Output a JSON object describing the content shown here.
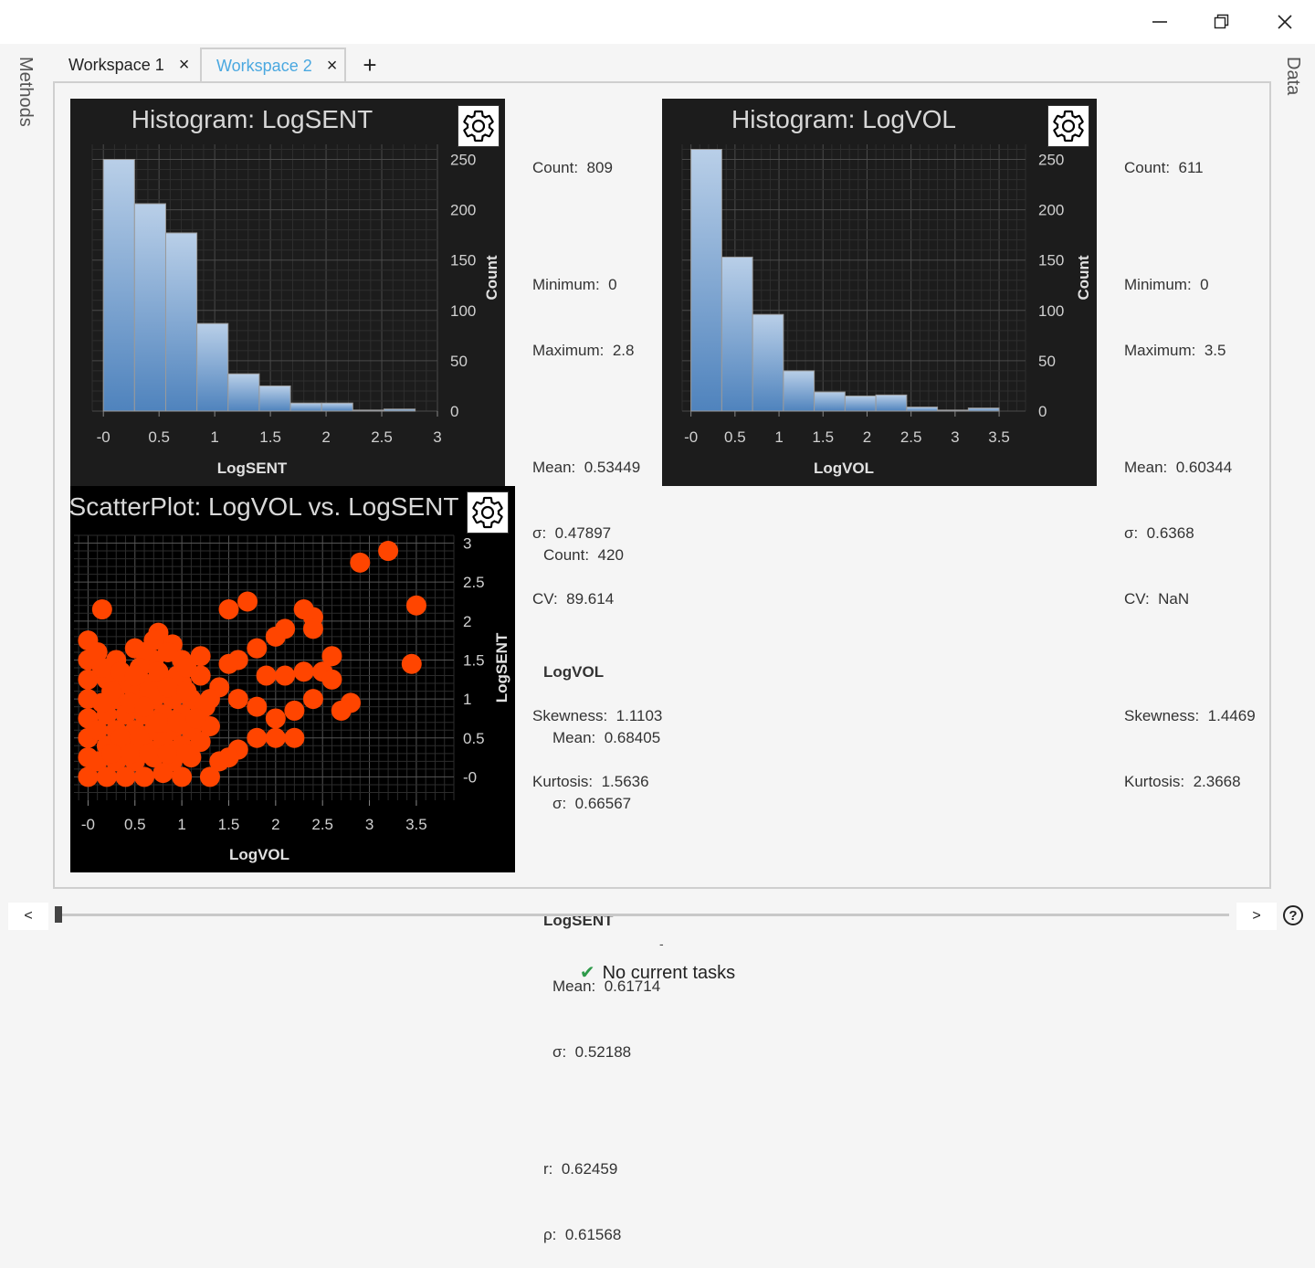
{
  "window": {
    "minimize_glyph": "—",
    "restore_glyph": "❐",
    "close_glyph": "✕"
  },
  "side": {
    "left_label": "Methods",
    "right_label": "Data"
  },
  "tabs": [
    {
      "label": "Workspace 1",
      "close": "×"
    },
    {
      "label": "Workspace 2",
      "close": "×"
    }
  ],
  "add_tab": "+",
  "histograms": [
    {
      "title": "Histogram: LogSENT",
      "xlabel": "LogSENT",
      "ylabel": "Count",
      "stats": {
        "count": "Count:  809",
        "min": "Minimum:  0",
        "max": "Maximum:  2.8",
        "mean": "Mean:  0.53449",
        "sigma": "σ:  0.47897",
        "cv": "CV:  89.614",
        "skew": "Skewness:  1.1103",
        "kurt": "Kurtosis:  1.5636"
      }
    },
    {
      "title": "Histogram: LogVOL",
      "xlabel": "LogVOL",
      "ylabel": "Count",
      "stats": {
        "count": "Count:  611",
        "min": "Minimum:  0",
        "max": "Maximum:  3.5",
        "mean": "Mean:  0.60344",
        "sigma": "σ:  0.6368",
        "cv": "CV:  NaN",
        "skew": "Skewness:  1.4469",
        "kurt": "Kurtosis:  2.3668"
      }
    }
  ],
  "scatter": {
    "title": "ScatterPlot: LogVOL vs. LogSENT",
    "xlabel": "LogVOL",
    "ylabel": "LogSENT",
    "stats": {
      "count": "Count:  420",
      "var1": "LogVOL",
      "var1_mean": "Mean:  0.68405",
      "var1_sigma": "σ:  0.66567",
      "var2": "LogSENT",
      "var2_mean": "Mean:  0.61714",
      "var2_sigma": "σ:  0.52188",
      "r": "r:  0.62459",
      "rho": "ρ:  0.61568"
    }
  },
  "chart_data": [
    {
      "type": "bar",
      "title": "Histogram: LogSENT",
      "xlabel": "LogSENT",
      "ylabel": "Count",
      "x_ticks": [
        "-0",
        "0.5",
        "1",
        "1.5",
        "2",
        "2.5",
        "3"
      ],
      "y_ticks": [
        "0",
        "50",
        "100",
        "150",
        "200",
        "250"
      ],
      "bin_width": 0.28,
      "bin_starts": [
        0,
        0.28,
        0.56,
        0.84,
        1.12,
        1.4,
        1.68,
        1.96,
        2.24,
        2.52
      ],
      "values": [
        250,
        206,
        177,
        87,
        37,
        25,
        8,
        8,
        1,
        2
      ],
      "xlim": [
        -0.1,
        3.0
      ],
      "ylim": [
        0,
        265
      ]
    },
    {
      "type": "bar",
      "title": "Histogram: LogVOL",
      "xlabel": "LogVOL",
      "ylabel": "Count",
      "x_ticks": [
        "-0",
        "0.5",
        "1",
        "1.5",
        "2",
        "2.5",
        "3",
        "3.5"
      ],
      "y_ticks": [
        "0",
        "50",
        "100",
        "150",
        "200",
        "250"
      ],
      "bin_width": 0.35,
      "bin_starts": [
        0,
        0.35,
        0.7,
        1.05,
        1.4,
        1.75,
        2.1,
        2.45,
        2.8,
        3.15
      ],
      "values": [
        260,
        153,
        96,
        40,
        19,
        15,
        16,
        4,
        1,
        3
      ],
      "xlim": [
        -0.1,
        3.8
      ],
      "ylim": [
        0,
        265
      ]
    },
    {
      "type": "scatter",
      "title": "ScatterPlot: LogVOL vs. LogSENT",
      "xlabel": "LogVOL",
      "ylabel": "LogSENT",
      "x_ticks": [
        "-0",
        "0.5",
        "1",
        "1.5",
        "2",
        "2.5",
        "3",
        "3.5"
      ],
      "y_ticks": [
        "-0",
        "0.5",
        "1",
        "1.5",
        "2",
        "2.5",
        "3"
      ],
      "xlim": [
        -0.15,
        3.9
      ],
      "ylim": [
        -0.3,
        3.1
      ],
      "point_color": "#ff4500",
      "points": [
        [
          3.2,
          2.9
        ],
        [
          2.9,
          2.75
        ],
        [
          3.5,
          2.2
        ],
        [
          3.45,
          1.45
        ],
        [
          1.5,
          2.15
        ],
        [
          1.7,
          2.25
        ],
        [
          2.3,
          2.15
        ],
        [
          2.4,
          2.05
        ],
        [
          2.4,
          1.9
        ],
        [
          2.1,
          1.9
        ],
        [
          2.0,
          1.8
        ],
        [
          1.8,
          1.65
        ],
        [
          1.6,
          1.5
        ],
        [
          1.5,
          1.45
        ],
        [
          2.6,
          1.55
        ],
        [
          2.5,
          1.35
        ],
        [
          2.3,
          1.35
        ],
        [
          2.1,
          1.3
        ],
        [
          1.9,
          1.3
        ],
        [
          2.6,
          1.25
        ],
        [
          2.4,
          1.0
        ],
        [
          2.2,
          0.85
        ],
        [
          2.0,
          0.75
        ],
        [
          1.8,
          0.9
        ],
        [
          1.6,
          1.0
        ],
        [
          1.4,
          1.15
        ],
        [
          1.2,
          1.3
        ],
        [
          2.8,
          0.95
        ],
        [
          2.7,
          0.85
        ],
        [
          2.2,
          0.5
        ],
        [
          2.0,
          0.5
        ],
        [
          1.8,
          0.5
        ],
        [
          1.6,
          0.35
        ],
        [
          1.5,
          0.25
        ],
        [
          1.4,
          0.2
        ],
        [
          0.15,
          2.15
        ],
        [
          0.0,
          1.75
        ],
        [
          0.0,
          1.5
        ],
        [
          0.0,
          1.25
        ],
        [
          0.0,
          1.0
        ],
        [
          0.0,
          0.75
        ],
        [
          0.0,
          0.5
        ],
        [
          0.0,
          0.25
        ],
        [
          0.0,
          0.0
        ],
        [
          0.1,
          1.6
        ],
        [
          0.3,
          1.5
        ],
        [
          0.5,
          1.65
        ],
        [
          0.75,
          1.85
        ],
        [
          0.9,
          1.7
        ],
        [
          1.0,
          1.5
        ],
        [
          1.2,
          1.55
        ],
        [
          0.7,
          1.5
        ],
        [
          0.6,
          1.6
        ],
        [
          0.2,
          1.25
        ],
        [
          0.4,
          1.2
        ],
        [
          0.6,
          1.2
        ],
        [
          0.8,
          1.25
        ],
        [
          1.0,
          1.2
        ],
        [
          0.3,
          1.0
        ],
        [
          0.5,
          1.05
        ],
        [
          0.7,
          1.0
        ],
        [
          0.9,
          1.0
        ],
        [
          1.1,
          1.0
        ],
        [
          1.3,
          1.0
        ],
        [
          0.2,
          0.8
        ],
        [
          0.4,
          0.8
        ],
        [
          0.6,
          0.8
        ],
        [
          0.8,
          0.8
        ],
        [
          1.0,
          0.8
        ],
        [
          1.2,
          0.85
        ],
        [
          0.3,
          0.6
        ],
        [
          0.5,
          0.6
        ],
        [
          0.7,
          0.6
        ],
        [
          0.9,
          0.6
        ],
        [
          1.1,
          0.6
        ],
        [
          1.3,
          0.65
        ],
        [
          0.2,
          0.4
        ],
        [
          0.4,
          0.4
        ],
        [
          0.6,
          0.4
        ],
        [
          0.8,
          0.45
        ],
        [
          1.0,
          0.4
        ],
        [
          0.1,
          0.2
        ],
        [
          0.3,
          0.2
        ],
        [
          0.5,
          0.2
        ],
        [
          0.7,
          0.25
        ],
        [
          0.9,
          0.2
        ],
        [
          1.1,
          0.25
        ],
        [
          0.2,
          0.0
        ],
        [
          0.4,
          0.0
        ],
        [
          0.6,
          0.0
        ],
        [
          0.8,
          0.05
        ],
        [
          1.0,
          0.0
        ],
        [
          1.3,
          0.0
        ],
        [
          0.15,
          1.4
        ],
        [
          0.35,
          1.35
        ],
        [
          0.55,
          1.4
        ],
        [
          0.75,
          1.35
        ],
        [
          0.95,
          1.3
        ],
        [
          0.25,
          1.1
        ],
        [
          0.45,
          0.95
        ],
        [
          0.65,
          1.1
        ],
        [
          0.85,
          1.15
        ],
        [
          1.05,
          1.1
        ],
        [
          1.25,
          0.9
        ],
        [
          0.1,
          0.6
        ],
        [
          0.15,
          0.95
        ],
        [
          0.35,
          0.5
        ],
        [
          0.55,
          0.5
        ],
        [
          0.75,
          0.7
        ],
        [
          0.95,
          0.7
        ],
        [
          1.15,
          0.75
        ],
        [
          0.25,
          0.3
        ],
        [
          0.45,
          0.3
        ],
        [
          0.65,
          0.3
        ],
        [
          0.85,
          0.3
        ],
        [
          1.05,
          0.3
        ],
        [
          1.2,
          0.45
        ],
        [
          0.7,
          1.75
        ],
        [
          0.85,
          1.6
        ],
        [
          1.05,
          1.4
        ],
        [
          0.5,
          1.3
        ],
        [
          0.6,
          0.9
        ]
      ]
    }
  ]
}
